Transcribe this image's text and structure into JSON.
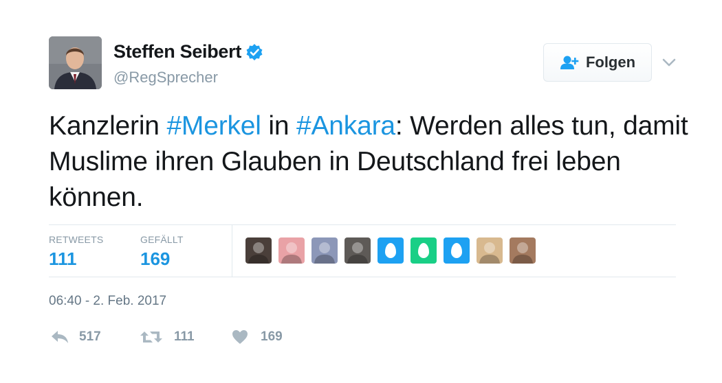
{
  "author": {
    "name": "Steffen Seibert",
    "handle": "@RegSprecher",
    "verified": true
  },
  "follow_button": {
    "label": "Folgen"
  },
  "tweet": {
    "text_parts": [
      {
        "text": "Kanzlerin ",
        "hashtag": false
      },
      {
        "text": "#Merkel",
        "hashtag": true
      },
      {
        "text": " in ",
        "hashtag": false
      },
      {
        "text": "#Ankara",
        "hashtag": true
      },
      {
        "text": ": Werden alles tun, damit Muslime ihren Glauben in Deutschland frei leben können.",
        "hashtag": false
      }
    ]
  },
  "stats": {
    "retweets_label": "RETWEETS",
    "retweets_value": "111",
    "likes_label": "GEFÄLLT",
    "likes_value": "169"
  },
  "likers": [
    {
      "kind": "photo",
      "icon": "user-photo-icon",
      "color": "#4a3f3a"
    },
    {
      "kind": "photo",
      "icon": "user-photo-icon",
      "color": "#e9a2a6"
    },
    {
      "kind": "photo",
      "icon": "user-photo-icon",
      "color": "#8c97b8"
    },
    {
      "kind": "photo",
      "icon": "user-photo-icon",
      "color": "#5e5a57"
    },
    {
      "kind": "egg",
      "icon": "default-egg-icon",
      "color": "#1da1f2"
    },
    {
      "kind": "egg",
      "icon": "default-egg-icon",
      "color": "#19cf86"
    },
    {
      "kind": "egg",
      "icon": "default-egg-icon",
      "color": "#1da1f2"
    },
    {
      "kind": "photo",
      "icon": "bird-photo-icon",
      "color": "#d8b98f"
    },
    {
      "kind": "photo",
      "icon": "user-photo-icon",
      "color": "#a47a5f"
    }
  ],
  "timestamp": "06:40 - 2. Feb. 2017",
  "actions": {
    "reply_count": "517",
    "retweet_count": "111",
    "like_count": "169"
  },
  "colors": {
    "accent": "#1b95e0",
    "muted": "#8899a6",
    "text": "#14171a",
    "border": "#e1e8ed"
  }
}
